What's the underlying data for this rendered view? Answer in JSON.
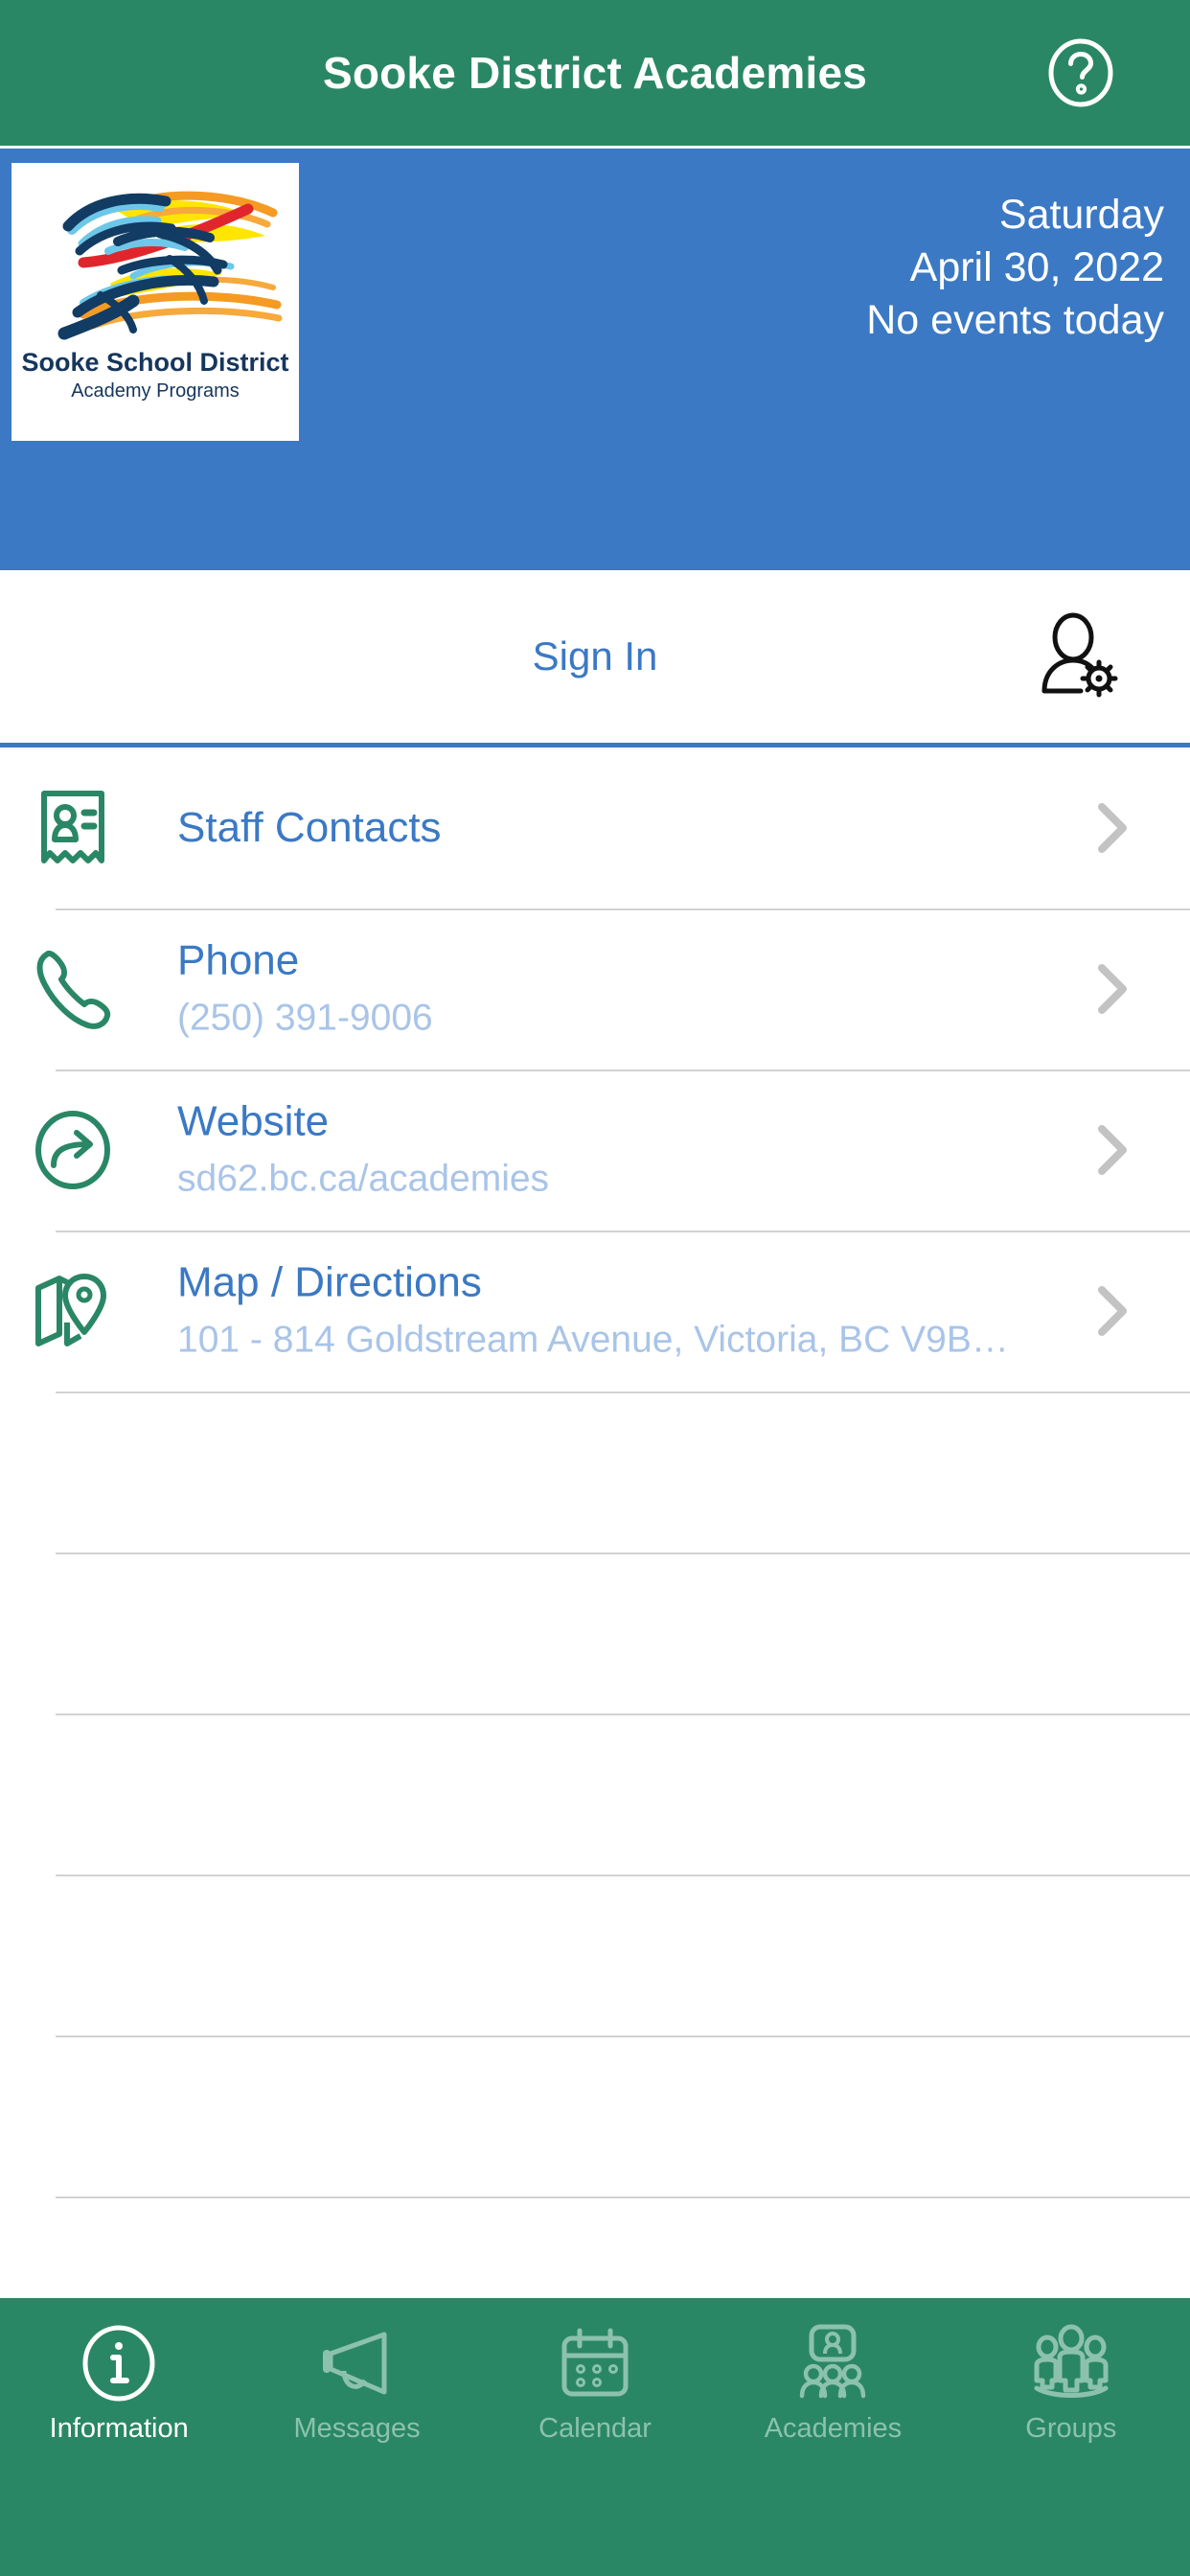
{
  "header": {
    "title": "Sooke District Academies",
    "help_icon": "help-circle-icon",
    "bg_color": "#2a8765"
  },
  "banner": {
    "bg_color": "#3b79c4",
    "logo": {
      "icon": "sooke-school-district-runner-logo",
      "line1": "Sooke School District",
      "line2": "Academy Programs"
    },
    "day": "Saturday",
    "date": "April 30, 2022",
    "events": "No events today"
  },
  "signin": {
    "label": "Sign In",
    "account_icon": "user-settings-icon",
    "accent_color": "#3b79c4"
  },
  "list": {
    "items": [
      {
        "title": "Staff Contacts",
        "subtitle": "",
        "icon": "contact-card-icon"
      },
      {
        "title": "Phone",
        "subtitle": "(250) 391-9006",
        "icon": "phone-icon"
      },
      {
        "title": "Website",
        "subtitle": "sd62.bc.ca/academies",
        "icon": "external-link-circle-icon"
      },
      {
        "title": "Map / Directions",
        "subtitle": "101 - 814 Goldstream Avenue, Victoria, BC V9B…",
        "icon": "map-pin-icon"
      }
    ],
    "chevron_icon": "chevron-right-icon",
    "title_color": "#3b79c4",
    "subtitle_color": "#a9c4e8",
    "icon_color": "#2a8765"
  },
  "tabbar": {
    "bg_color": "#2a8765",
    "active_color": "#ffffff",
    "inactive_color": "#8cc2ad",
    "tabs": [
      {
        "label": "Information",
        "icon": "info-circle-icon",
        "active": true
      },
      {
        "label": "Messages",
        "icon": "megaphone-icon",
        "active": false
      },
      {
        "label": "Calendar",
        "icon": "calendar-icon",
        "active": false
      },
      {
        "label": "Academies",
        "icon": "screen-people-icon",
        "active": false
      },
      {
        "label": "Groups",
        "icon": "people-group-icon",
        "active": false
      }
    ]
  }
}
